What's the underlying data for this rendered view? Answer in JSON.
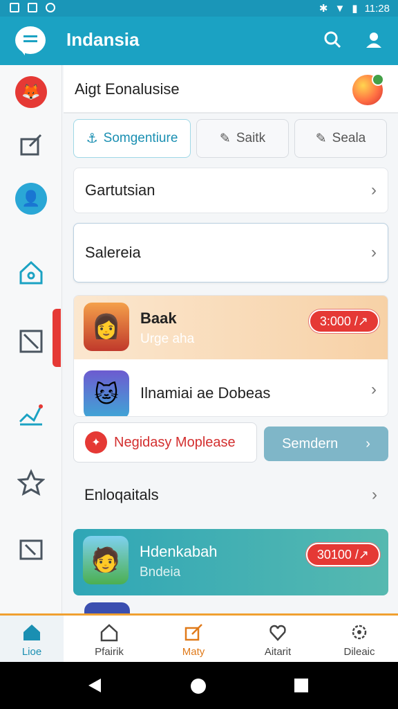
{
  "status": {
    "time": "11:28"
  },
  "appbar": {
    "title": "Indansia"
  },
  "header": {
    "title": "Aigt Eonalusise"
  },
  "chips": [
    {
      "label": "Somgentiure",
      "icon": "hand-icon"
    },
    {
      "label": "Saitk",
      "icon": "pin-icon"
    },
    {
      "label": "Seala",
      "icon": "pin-icon"
    }
  ],
  "rows": {
    "row1": "Gartutsian",
    "row2": "Salereia",
    "row3": "Enloqaitals"
  },
  "card1": {
    "title": "Baak",
    "subtitle": "Urge aha",
    "price": "3:000 /↗"
  },
  "card2": {
    "title": "Ilnamiai ae Dobeas"
  },
  "buttons": {
    "left": "Negidasy Moplease",
    "right": "Semdern"
  },
  "card3": {
    "title": "Hdenkabah",
    "subtitle": "Bndeia",
    "price": "30100 /↗"
  },
  "bottom_nav": [
    {
      "label": "Lioe"
    },
    {
      "label": "Pfairik"
    },
    {
      "label": "Maty"
    },
    {
      "label": "Aitarit"
    },
    {
      "label": "Dileaic"
    }
  ],
  "colors": {
    "primary": "#1ba2c3",
    "accent": "#e53935",
    "active_tab": "#e07a1a"
  }
}
